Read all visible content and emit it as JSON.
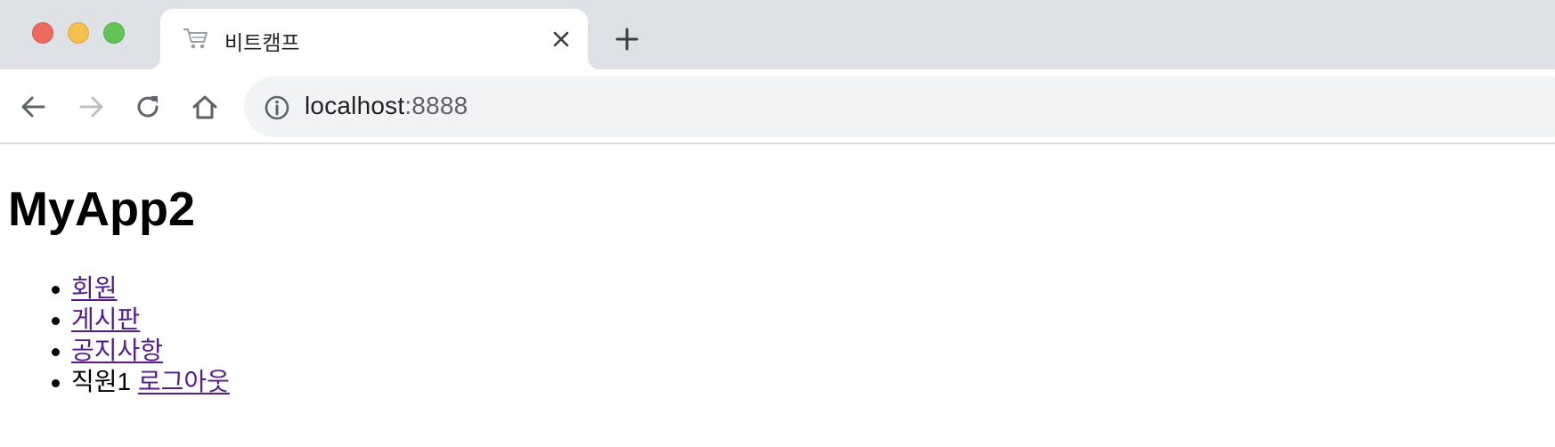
{
  "window": {
    "traffic_lights": [
      "close",
      "minimize",
      "maximize"
    ]
  },
  "tab": {
    "title": "비트캠프",
    "favicon": "cart-icon"
  },
  "toolbar": {
    "url_host": "localhost",
    "url_port": ":8888"
  },
  "page": {
    "title": "MyApp2",
    "menu": {
      "member": "회원",
      "board": "게시판",
      "notice": "공지사항",
      "user_name": "직원1",
      "logout": "로그아웃"
    }
  },
  "colors": {
    "tabstrip_bg": "#dee1e6",
    "omnibox_bg": "#f1f3f4",
    "visited_link": "#551a8b"
  }
}
